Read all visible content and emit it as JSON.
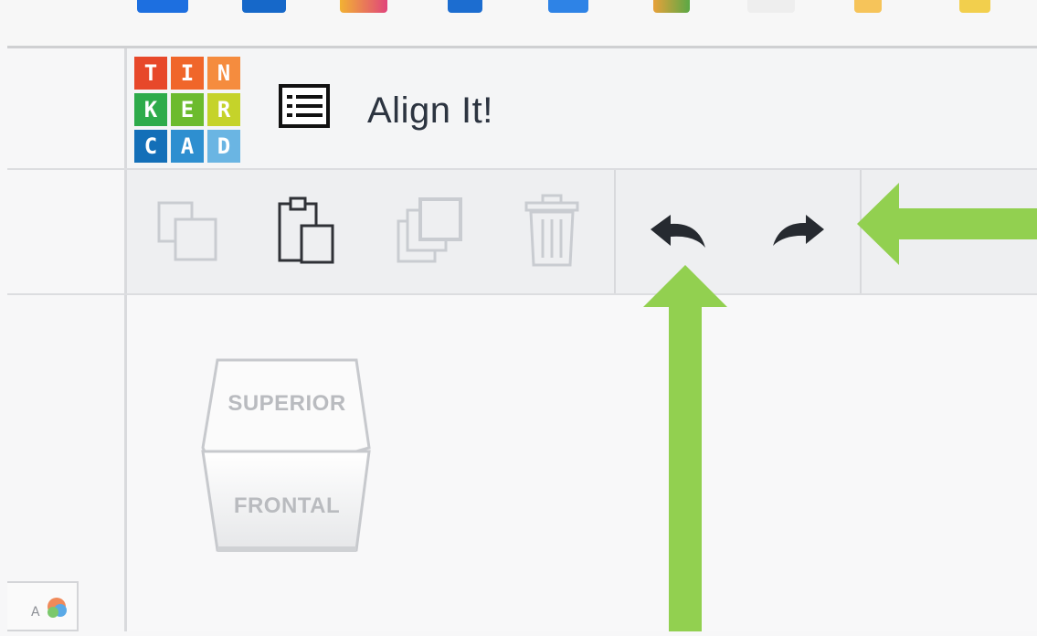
{
  "app": {
    "logo_letters": [
      "T",
      "I",
      "N",
      "K",
      "E",
      "R",
      "C",
      "A",
      "D"
    ],
    "logo_colors": [
      "#e7482a",
      "#f0662a",
      "#f58c3e",
      "#2eab4a",
      "#6cbb2e",
      "#c5d32a",
      "#136fb8",
      "#2e8fd0",
      "#6ab5e3"
    ],
    "design_title": "Align It!"
  },
  "toolbar": {
    "copy_icon": "copy-icon",
    "paste_icon": "paste-icon",
    "duplicate_icon": "duplicate-icon",
    "delete_icon": "trash-icon",
    "undo_icon": "undo-icon",
    "redo_icon": "redo-icon"
  },
  "view_cube": {
    "top_face": "SUPERIOR",
    "front_face": "FRONTAL"
  },
  "annotations": {
    "arrow_color": "#92d050"
  }
}
